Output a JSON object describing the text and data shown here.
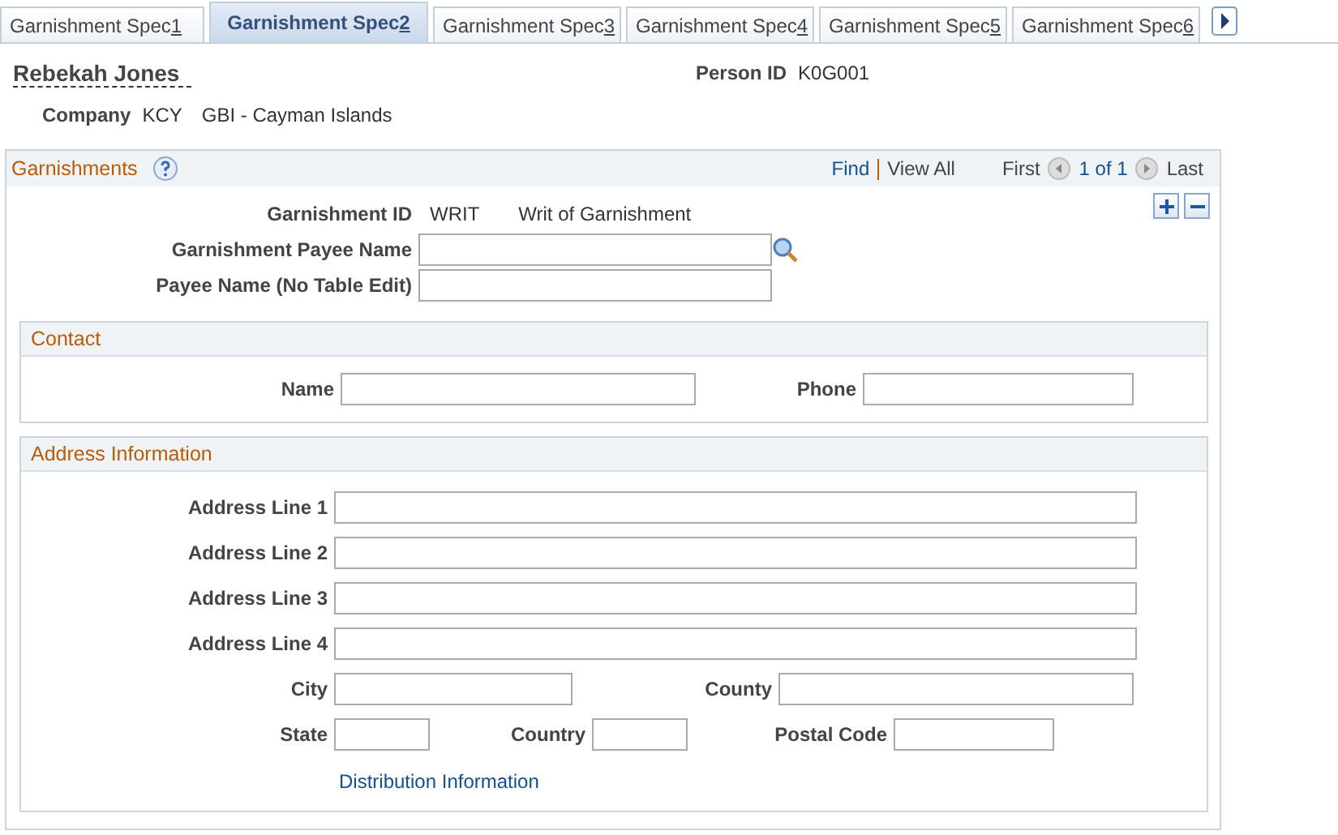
{
  "tabs": [
    {
      "label": "Garnishment Spec",
      "key": "1",
      "selected": false
    },
    {
      "label": "Garnishment Spec",
      "key": "2",
      "selected": true
    },
    {
      "label": "Garnishment Spec",
      "key": "3",
      "selected": false
    },
    {
      "label": "Garnishment Spec",
      "key": "4",
      "selected": false
    },
    {
      "label": "Garnishment Spec",
      "key": "5",
      "selected": false
    },
    {
      "label": "Garnishment Spec",
      "key": "6",
      "selected": false
    }
  ],
  "header": {
    "name": "Rebekah Jones",
    "person_id_label": "Person ID",
    "person_id": "K0G001",
    "company_label": "Company",
    "company_code": "KCY",
    "company_name": "GBI - Cayman Islands"
  },
  "garnishments": {
    "title": "Garnishments",
    "find": "Find",
    "view_all": "View All",
    "first": "First",
    "count": "1 of 1",
    "last": "Last",
    "id_label": "Garnishment ID",
    "id": "WRIT",
    "id_desc": "Writ of Garnishment",
    "payee_label": "Garnishment Payee Name",
    "payee_no_edit_label": "Payee Name (No Table Edit)"
  },
  "contact": {
    "title": "Contact",
    "name_label": "Name",
    "phone_label": "Phone"
  },
  "address": {
    "title": "Address Information",
    "lines": [
      "Address Line 1",
      "Address Line 2",
      "Address Line 3",
      "Address Line 4"
    ],
    "city_label": "City",
    "county_label": "County",
    "state_label": "State",
    "country_label": "Country",
    "postal_label": "Postal Code",
    "link": "Distribution Information"
  }
}
